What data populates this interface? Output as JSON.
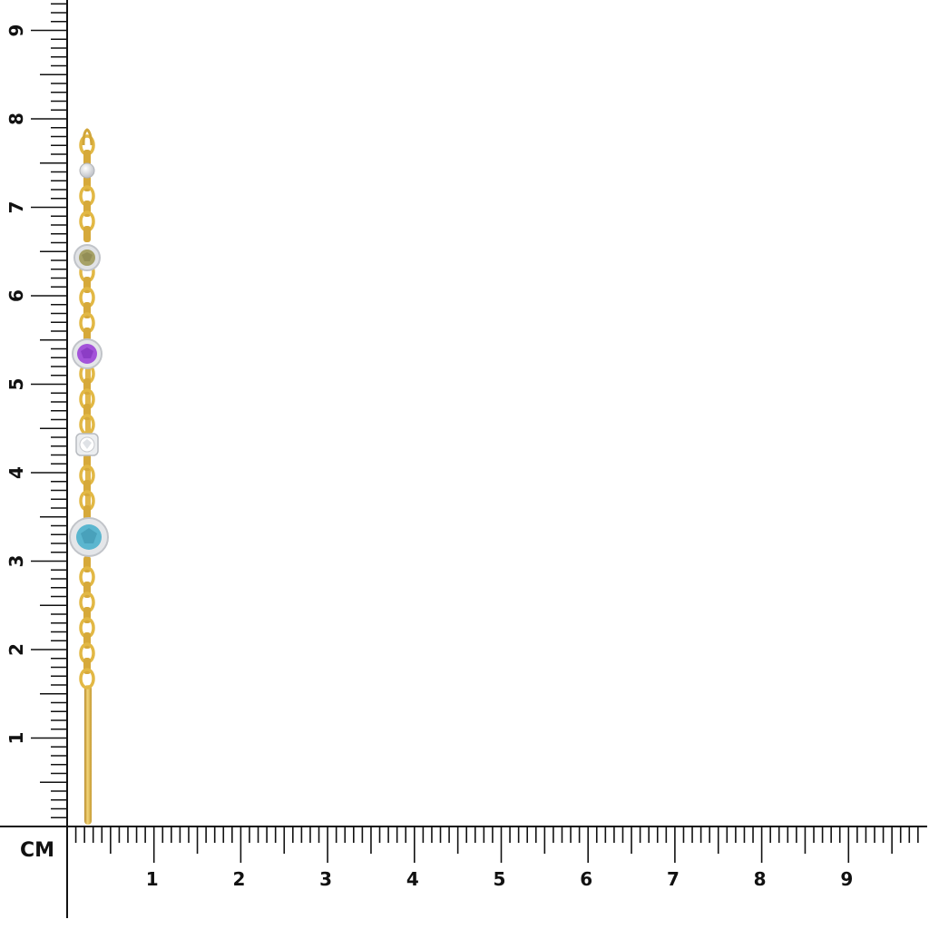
{
  "ruler": {
    "unit_label": "CM",
    "y_labels": [
      "1",
      "2",
      "3",
      "4",
      "5",
      "6",
      "7",
      "8",
      "9"
    ],
    "x_labels": [
      "1",
      "2",
      "3",
      "4",
      "5",
      "6",
      "7",
      "8",
      "9"
    ]
  },
  "product": {
    "description_visible": false,
    "stones": [
      {
        "name": "pearl-bead",
        "color": "#e8e8e8"
      },
      {
        "name": "peridot-stone",
        "color": "#a5a06a"
      },
      {
        "name": "amethyst-stone",
        "color": "#a050d8"
      },
      {
        "name": "diamond-stone",
        "color": "#f2f2f2"
      },
      {
        "name": "aquamarine-stone",
        "color": "#5cb7cf"
      }
    ],
    "metal_color": "#e2b845",
    "setting_color": "#d8dadd"
  }
}
